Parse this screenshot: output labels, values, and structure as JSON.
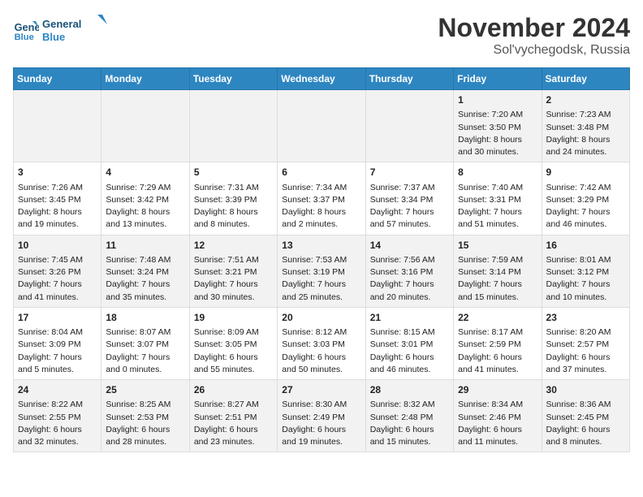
{
  "header": {
    "logo_line1": "General",
    "logo_line2": "Blue",
    "month": "November 2024",
    "location": "Sol'vychegodsk, Russia"
  },
  "days_of_week": [
    "Sunday",
    "Monday",
    "Tuesday",
    "Wednesday",
    "Thursday",
    "Friday",
    "Saturday"
  ],
  "weeks": [
    [
      {
        "day": "",
        "content": ""
      },
      {
        "day": "",
        "content": ""
      },
      {
        "day": "",
        "content": ""
      },
      {
        "day": "",
        "content": ""
      },
      {
        "day": "",
        "content": ""
      },
      {
        "day": "1",
        "content": "Sunrise: 7:20 AM\nSunset: 3:50 PM\nDaylight: 8 hours\nand 30 minutes."
      },
      {
        "day": "2",
        "content": "Sunrise: 7:23 AM\nSunset: 3:48 PM\nDaylight: 8 hours\nand 24 minutes."
      }
    ],
    [
      {
        "day": "3",
        "content": "Sunrise: 7:26 AM\nSunset: 3:45 PM\nDaylight: 8 hours\nand 19 minutes."
      },
      {
        "day": "4",
        "content": "Sunrise: 7:29 AM\nSunset: 3:42 PM\nDaylight: 8 hours\nand 13 minutes."
      },
      {
        "day": "5",
        "content": "Sunrise: 7:31 AM\nSunset: 3:39 PM\nDaylight: 8 hours\nand 8 minutes."
      },
      {
        "day": "6",
        "content": "Sunrise: 7:34 AM\nSunset: 3:37 PM\nDaylight: 8 hours\nand 2 minutes."
      },
      {
        "day": "7",
        "content": "Sunrise: 7:37 AM\nSunset: 3:34 PM\nDaylight: 7 hours\nand 57 minutes."
      },
      {
        "day": "8",
        "content": "Sunrise: 7:40 AM\nSunset: 3:31 PM\nDaylight: 7 hours\nand 51 minutes."
      },
      {
        "day": "9",
        "content": "Sunrise: 7:42 AM\nSunset: 3:29 PM\nDaylight: 7 hours\nand 46 minutes."
      }
    ],
    [
      {
        "day": "10",
        "content": "Sunrise: 7:45 AM\nSunset: 3:26 PM\nDaylight: 7 hours\nand 41 minutes."
      },
      {
        "day": "11",
        "content": "Sunrise: 7:48 AM\nSunset: 3:24 PM\nDaylight: 7 hours\nand 35 minutes."
      },
      {
        "day": "12",
        "content": "Sunrise: 7:51 AM\nSunset: 3:21 PM\nDaylight: 7 hours\nand 30 minutes."
      },
      {
        "day": "13",
        "content": "Sunrise: 7:53 AM\nSunset: 3:19 PM\nDaylight: 7 hours\nand 25 minutes."
      },
      {
        "day": "14",
        "content": "Sunrise: 7:56 AM\nSunset: 3:16 PM\nDaylight: 7 hours\nand 20 minutes."
      },
      {
        "day": "15",
        "content": "Sunrise: 7:59 AM\nSunset: 3:14 PM\nDaylight: 7 hours\nand 15 minutes."
      },
      {
        "day": "16",
        "content": "Sunrise: 8:01 AM\nSunset: 3:12 PM\nDaylight: 7 hours\nand 10 minutes."
      }
    ],
    [
      {
        "day": "17",
        "content": "Sunrise: 8:04 AM\nSunset: 3:09 PM\nDaylight: 7 hours\nand 5 minutes."
      },
      {
        "day": "18",
        "content": "Sunrise: 8:07 AM\nSunset: 3:07 PM\nDaylight: 7 hours\nand 0 minutes."
      },
      {
        "day": "19",
        "content": "Sunrise: 8:09 AM\nSunset: 3:05 PM\nDaylight: 6 hours\nand 55 minutes."
      },
      {
        "day": "20",
        "content": "Sunrise: 8:12 AM\nSunset: 3:03 PM\nDaylight: 6 hours\nand 50 minutes."
      },
      {
        "day": "21",
        "content": "Sunrise: 8:15 AM\nSunset: 3:01 PM\nDaylight: 6 hours\nand 46 minutes."
      },
      {
        "day": "22",
        "content": "Sunrise: 8:17 AM\nSunset: 2:59 PM\nDaylight: 6 hours\nand 41 minutes."
      },
      {
        "day": "23",
        "content": "Sunrise: 8:20 AM\nSunset: 2:57 PM\nDaylight: 6 hours\nand 37 minutes."
      }
    ],
    [
      {
        "day": "24",
        "content": "Sunrise: 8:22 AM\nSunset: 2:55 PM\nDaylight: 6 hours\nand 32 minutes."
      },
      {
        "day": "25",
        "content": "Sunrise: 8:25 AM\nSunset: 2:53 PM\nDaylight: 6 hours\nand 28 minutes."
      },
      {
        "day": "26",
        "content": "Sunrise: 8:27 AM\nSunset: 2:51 PM\nDaylight: 6 hours\nand 23 minutes."
      },
      {
        "day": "27",
        "content": "Sunrise: 8:30 AM\nSunset: 2:49 PM\nDaylight: 6 hours\nand 19 minutes."
      },
      {
        "day": "28",
        "content": "Sunrise: 8:32 AM\nSunset: 2:48 PM\nDaylight: 6 hours\nand 15 minutes."
      },
      {
        "day": "29",
        "content": "Sunrise: 8:34 AM\nSunset: 2:46 PM\nDaylight: 6 hours\nand 11 minutes."
      },
      {
        "day": "30",
        "content": "Sunrise: 8:36 AM\nSunset: 2:45 PM\nDaylight: 6 hours\nand 8 minutes."
      }
    ]
  ]
}
